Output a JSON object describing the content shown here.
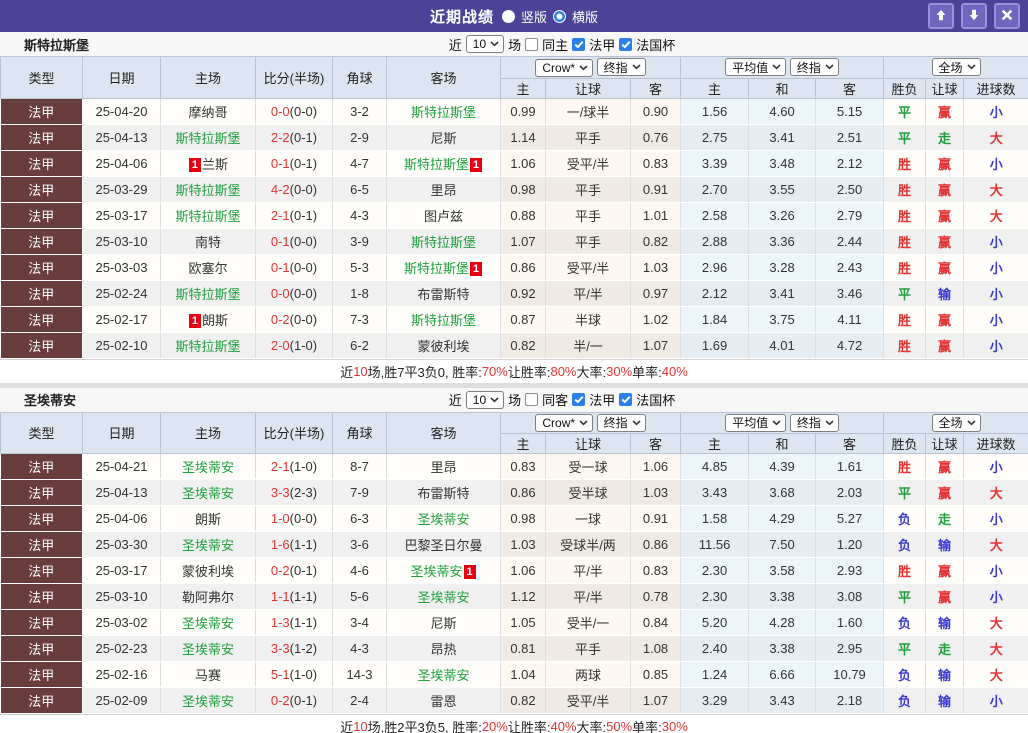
{
  "title_bar": {
    "title": "近期战绩",
    "portrait_label": "竖版",
    "landscape_label": "横版",
    "icons": [
      "arrow-up-icon",
      "arrow-down-icon",
      "close-icon"
    ]
  },
  "colors": {
    "accent_purple": "#4c4398",
    "header_blue": "#dce5f0",
    "league_cell": "#6a3d3d",
    "team_highlight_green": "#1fa03c",
    "score_red": "#e23333",
    "checkbox_blue": "#2a7fe8"
  },
  "result_colors": {
    "胜": "#e23333",
    "平": "#1fa03c",
    "负": "#3a3ad0",
    "赢": "#e23333",
    "走": "#1fa03c",
    "输": "#3a3ad0",
    "大": "#e23333",
    "小": "#3a3ad0"
  },
  "red_card_label": "1",
  "column_headers": {
    "main": [
      "类型",
      "日期",
      "主场",
      "比分(半场)",
      "角球",
      "客场"
    ],
    "sub": [
      "主",
      "让球",
      "客",
      "主",
      "和",
      "客",
      "胜负",
      "让球",
      "进球数"
    ]
  },
  "sections": [
    {
      "team": "斯特拉斯堡",
      "filter": {
        "prefix": "近",
        "match_count": "10",
        "suffix": "场",
        "checkboxes": [
          {
            "label": "同主",
            "checked": false
          },
          {
            "label": "法甲",
            "checked": true
          },
          {
            "label": "法国杯",
            "checked": true
          }
        ]
      },
      "selects": {
        "odds_source": "Crow*",
        "odds_stage": "终指",
        "avg_source": "平均值",
        "avg_stage": "终指",
        "scope": "全场"
      },
      "rows": [
        {
          "league": "法甲",
          "date": "25-04-20",
          "home": "摩纳哥",
          "home_hl": false,
          "home_card": false,
          "score": "0-0",
          "half": "(0-0)",
          "corners": "3-2",
          "away": "斯特拉斯堡",
          "away_hl": true,
          "away_card": false,
          "crow": [
            "0.99",
            "一/球半",
            "0.90"
          ],
          "avg": [
            "1.56",
            "4.60",
            "5.15"
          ],
          "results": [
            "平",
            "赢",
            "小"
          ]
        },
        {
          "league": "法甲",
          "date": "25-04-13",
          "home": "斯特拉斯堡",
          "home_hl": true,
          "home_card": false,
          "score": "2-2",
          "half": "(0-1)",
          "corners": "2-9",
          "away": "尼斯",
          "away_hl": false,
          "away_card": false,
          "crow": [
            "1.14",
            "平手",
            "0.76"
          ],
          "avg": [
            "2.75",
            "3.41",
            "2.51"
          ],
          "results": [
            "平",
            "走",
            "大"
          ]
        },
        {
          "league": "法甲",
          "date": "25-04-06",
          "home": "兰斯",
          "home_hl": false,
          "home_card": true,
          "score": "0-1",
          "half": "(0-1)",
          "corners": "4-7",
          "away": "斯特拉斯堡",
          "away_hl": true,
          "away_card": true,
          "crow": [
            "1.06",
            "受平/半",
            "0.83"
          ],
          "avg": [
            "3.39",
            "3.48",
            "2.12"
          ],
          "results": [
            "胜",
            "赢",
            "小"
          ]
        },
        {
          "league": "法甲",
          "date": "25-03-29",
          "home": "斯特拉斯堡",
          "home_hl": true,
          "home_card": false,
          "score": "4-2",
          "half": "(0-0)",
          "corners": "6-5",
          "away": "里昂",
          "away_hl": false,
          "away_card": false,
          "crow": [
            "0.98",
            "平手",
            "0.91"
          ],
          "avg": [
            "2.70",
            "3.55",
            "2.50"
          ],
          "results": [
            "胜",
            "赢",
            "大"
          ]
        },
        {
          "league": "法甲",
          "date": "25-03-17",
          "home": "斯特拉斯堡",
          "home_hl": true,
          "home_card": false,
          "score": "2-1",
          "half": "(0-1)",
          "corners": "4-3",
          "away": "图卢兹",
          "away_hl": false,
          "away_card": false,
          "crow": [
            "0.88",
            "平手",
            "1.01"
          ],
          "avg": [
            "2.58",
            "3.26",
            "2.79"
          ],
          "results": [
            "胜",
            "赢",
            "大"
          ]
        },
        {
          "league": "法甲",
          "date": "25-03-10",
          "home": "南特",
          "home_hl": false,
          "home_card": false,
          "score": "0-1",
          "half": "(0-0)",
          "corners": "3-9",
          "away": "斯特拉斯堡",
          "away_hl": true,
          "away_card": false,
          "crow": [
            "1.07",
            "平手",
            "0.82"
          ],
          "avg": [
            "2.88",
            "3.36",
            "2.44"
          ],
          "results": [
            "胜",
            "赢",
            "小"
          ]
        },
        {
          "league": "法甲",
          "date": "25-03-03",
          "home": "欧塞尔",
          "home_hl": false,
          "home_card": false,
          "score": "0-1",
          "half": "(0-0)",
          "corners": "5-3",
          "away": "斯特拉斯堡",
          "away_hl": true,
          "away_card": true,
          "crow": [
            "0.86",
            "受平/半",
            "1.03"
          ],
          "avg": [
            "2.96",
            "3.28",
            "2.43"
          ],
          "results": [
            "胜",
            "赢",
            "小"
          ]
        },
        {
          "league": "法甲",
          "date": "25-02-24",
          "home": "斯特拉斯堡",
          "home_hl": true,
          "home_card": false,
          "score": "0-0",
          "half": "(0-0)",
          "corners": "1-8",
          "away": "布雷斯特",
          "away_hl": false,
          "away_card": false,
          "crow": [
            "0.92",
            "平/半",
            "0.97"
          ],
          "avg": [
            "2.12",
            "3.41",
            "3.46"
          ],
          "results": [
            "平",
            "输",
            "小"
          ]
        },
        {
          "league": "法甲",
          "date": "25-02-17",
          "home": "朗斯",
          "home_hl": false,
          "home_card": true,
          "score": "0-2",
          "half": "(0-0)",
          "corners": "7-3",
          "away": "斯特拉斯堡",
          "away_hl": true,
          "away_card": false,
          "crow": [
            "0.87",
            "半球",
            "1.02"
          ],
          "avg": [
            "1.84",
            "3.75",
            "4.11"
          ],
          "results": [
            "胜",
            "赢",
            "小"
          ]
        },
        {
          "league": "法甲",
          "date": "25-02-10",
          "home": "斯特拉斯堡",
          "home_hl": true,
          "home_card": false,
          "score": "2-0",
          "half": "(1-0)",
          "corners": "6-2",
          "away": "蒙彼利埃",
          "away_hl": false,
          "away_card": false,
          "crow": [
            "0.82",
            "半/一",
            "1.07"
          ],
          "avg": [
            "1.69",
            "4.01",
            "4.72"
          ],
          "results": [
            "胜",
            "赢",
            "小"
          ]
        }
      ],
      "summary": [
        {
          "text": "近",
          "red": false
        },
        {
          "text": "10",
          "red": true
        },
        {
          "text": "场,胜7平3负0, 胜率:",
          "red": false
        },
        {
          "text": "70%",
          "red": true
        },
        {
          "text": " 让胜率:",
          "red": false
        },
        {
          "text": "80%",
          "red": true
        },
        {
          "text": " 大率:",
          "red": false
        },
        {
          "text": "30%",
          "red": true
        },
        {
          "text": " 单率:",
          "red": false
        },
        {
          "text": "40%",
          "red": true
        }
      ]
    },
    {
      "team": "圣埃蒂安",
      "filter": {
        "prefix": "近",
        "match_count": "10",
        "suffix": "场",
        "checkboxes": [
          {
            "label": "同客",
            "checked": false
          },
          {
            "label": "法甲",
            "checked": true
          },
          {
            "label": "法国杯",
            "checked": true
          }
        ]
      },
      "selects": {
        "odds_source": "Crow*",
        "odds_stage": "终指",
        "avg_source": "平均值",
        "avg_stage": "终指",
        "scope": "全场"
      },
      "rows": [
        {
          "league": "法甲",
          "date": "25-04-21",
          "home": "圣埃蒂安",
          "home_hl": true,
          "home_card": false,
          "score": "2-1",
          "half": "(1-0)",
          "corners": "8-7",
          "away": "里昂",
          "away_hl": false,
          "away_card": false,
          "crow": [
            "0.83",
            "受一球",
            "1.06"
          ],
          "avg": [
            "4.85",
            "4.39",
            "1.61"
          ],
          "results": [
            "胜",
            "赢",
            "小"
          ]
        },
        {
          "league": "法甲",
          "date": "25-04-13",
          "home": "圣埃蒂安",
          "home_hl": true,
          "home_card": false,
          "score": "3-3",
          "half": "(2-3)",
          "corners": "7-9",
          "away": "布雷斯特",
          "away_hl": false,
          "away_card": false,
          "crow": [
            "0.86",
            "受半球",
            "1.03"
          ],
          "avg": [
            "3.43",
            "3.68",
            "2.03"
          ],
          "results": [
            "平",
            "赢",
            "大"
          ]
        },
        {
          "league": "法甲",
          "date": "25-04-06",
          "home": "朗斯",
          "home_hl": false,
          "home_card": false,
          "score": "1-0",
          "half": "(0-0)",
          "corners": "6-3",
          "away": "圣埃蒂安",
          "away_hl": true,
          "away_card": false,
          "crow": [
            "0.98",
            "一球",
            "0.91"
          ],
          "avg": [
            "1.58",
            "4.29",
            "5.27"
          ],
          "results": [
            "负",
            "走",
            "小"
          ]
        },
        {
          "league": "法甲",
          "date": "25-03-30",
          "home": "圣埃蒂安",
          "home_hl": true,
          "home_card": false,
          "score": "1-6",
          "half": "(1-1)",
          "corners": "3-6",
          "away": "巴黎圣日尔曼",
          "away_hl": false,
          "away_card": false,
          "crow": [
            "1.03",
            "受球半/两",
            "0.86"
          ],
          "avg": [
            "11.56",
            "7.50",
            "1.20"
          ],
          "results": [
            "负",
            "输",
            "大"
          ]
        },
        {
          "league": "法甲",
          "date": "25-03-17",
          "home": "蒙彼利埃",
          "home_hl": false,
          "home_card": false,
          "score": "0-2",
          "half": "(0-1)",
          "corners": "4-6",
          "away": "圣埃蒂安",
          "away_hl": true,
          "away_card": true,
          "crow": [
            "1.06",
            "平/半",
            "0.83"
          ],
          "avg": [
            "2.30",
            "3.58",
            "2.93"
          ],
          "results": [
            "胜",
            "赢",
            "小"
          ]
        },
        {
          "league": "法甲",
          "date": "25-03-10",
          "home": "勒阿弗尔",
          "home_hl": false,
          "home_card": false,
          "score": "1-1",
          "half": "(1-1)",
          "corners": "5-6",
          "away": "圣埃蒂安",
          "away_hl": true,
          "away_card": false,
          "crow": [
            "1.12",
            "平/半",
            "0.78"
          ],
          "avg": [
            "2.30",
            "3.38",
            "3.08"
          ],
          "results": [
            "平",
            "赢",
            "小"
          ]
        },
        {
          "league": "法甲",
          "date": "25-03-02",
          "home": "圣埃蒂安",
          "home_hl": true,
          "home_card": false,
          "score": "1-3",
          "half": "(1-1)",
          "corners": "3-4",
          "away": "尼斯",
          "away_hl": false,
          "away_card": false,
          "crow": [
            "1.05",
            "受半/一",
            "0.84"
          ],
          "avg": [
            "5.20",
            "4.28",
            "1.60"
          ],
          "results": [
            "负",
            "输",
            "大"
          ]
        },
        {
          "league": "法甲",
          "date": "25-02-23",
          "home": "圣埃蒂安",
          "home_hl": true,
          "home_card": false,
          "score": "3-3",
          "half": "(1-2)",
          "corners": "4-3",
          "away": "昂热",
          "away_hl": false,
          "away_card": false,
          "crow": [
            "0.81",
            "平手",
            "1.08"
          ],
          "avg": [
            "2.40",
            "3.38",
            "2.95"
          ],
          "results": [
            "平",
            "走",
            "大"
          ]
        },
        {
          "league": "法甲",
          "date": "25-02-16",
          "home": "马赛",
          "home_hl": false,
          "home_card": false,
          "score": "5-1",
          "half": "(1-0)",
          "corners": "14-3",
          "away": "圣埃蒂安",
          "away_hl": true,
          "away_card": false,
          "crow": [
            "1.04",
            "两球",
            "0.85"
          ],
          "avg": [
            "1.24",
            "6.66",
            "10.79"
          ],
          "results": [
            "负",
            "输",
            "大"
          ]
        },
        {
          "league": "法甲",
          "date": "25-02-09",
          "home": "圣埃蒂安",
          "home_hl": true,
          "home_card": false,
          "score": "0-2",
          "half": "(0-1)",
          "corners": "2-4",
          "away": "雷恩",
          "away_hl": false,
          "away_card": false,
          "crow": [
            "0.82",
            "受平/半",
            "1.07"
          ],
          "avg": [
            "3.29",
            "3.43",
            "2.18"
          ],
          "results": [
            "负",
            "输",
            "小"
          ]
        }
      ],
      "summary": [
        {
          "text": "近",
          "red": false
        },
        {
          "text": "10",
          "red": true
        },
        {
          "text": "场,胜2平3负5, 胜率:",
          "red": false
        },
        {
          "text": "20%",
          "red": true
        },
        {
          "text": " 让胜率:",
          "red": false
        },
        {
          "text": "40%",
          "red": true
        },
        {
          "text": " 大率:",
          "red": false
        },
        {
          "text": "50%",
          "red": true
        },
        {
          "text": " 单率:",
          "red": false
        },
        {
          "text": "30%",
          "red": true
        }
      ]
    }
  ]
}
